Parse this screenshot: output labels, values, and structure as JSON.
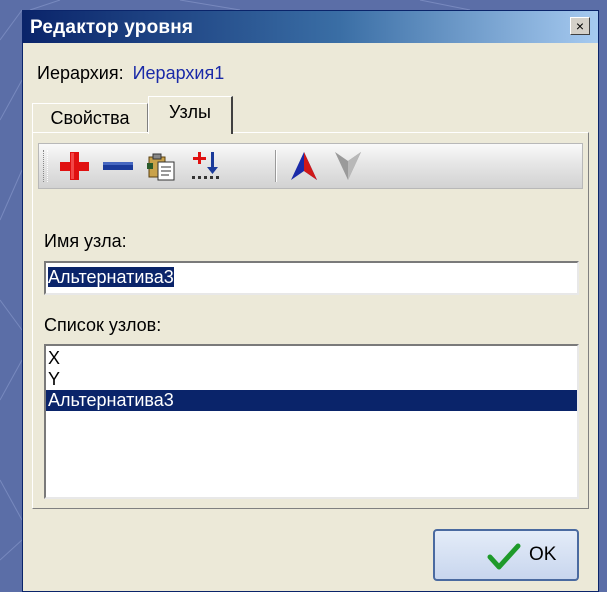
{
  "window": {
    "title": "Редактор уровня",
    "close_label": "×"
  },
  "hierarchy": {
    "label": "Иерархия:",
    "value": "Иерархия1"
  },
  "tabs": [
    {
      "label": "Свойства",
      "active": false
    },
    {
      "label": "Узлы",
      "active": true
    }
  ],
  "toolbar": {
    "buttons": [
      {
        "icon": "add-icon",
        "color": "#e01010"
      },
      {
        "icon": "remove-icon",
        "color": "#1a3a9a"
      },
      {
        "icon": "paste-node-icon"
      },
      {
        "icon": "sort-nodes-icon"
      },
      {
        "icon": "move-up-icon",
        "color": "#1a2aa8"
      },
      {
        "icon": "move-down-icon",
        "color": "#9a9a9a"
      }
    ]
  },
  "node_name": {
    "label": "Имя узла:",
    "value": "Альтернатива3"
  },
  "node_list": {
    "label": "Список узлов:",
    "items": [
      "X",
      "Y",
      "Альтернатива3"
    ],
    "selected_index": 2
  },
  "ok_button": {
    "label": "OK"
  },
  "colors": {
    "selection": "#0a246a",
    "titlebar": "#0a246a",
    "background": "#5b6ea7",
    "dialog": "#ece9d8"
  }
}
